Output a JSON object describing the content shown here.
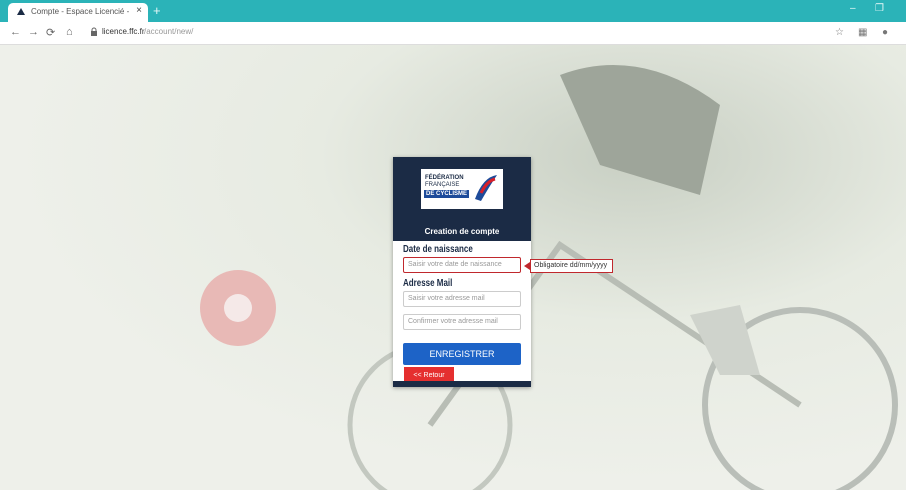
{
  "browser": {
    "tab_title": "Compte - Espace Licencié - FFC",
    "tab_close": "×",
    "new_tab": "+",
    "url_host": "licence.ffc.fr",
    "url_path": "/account/new/",
    "minimize": "–",
    "maximize": "❐"
  },
  "logo": {
    "line1": "FÉDÉRATION",
    "line2": "FRANÇAISE",
    "line3": "DE CYCLISME"
  },
  "form": {
    "title": "Creation de compte",
    "dob_label": "Date de naissance",
    "dob_placeholder": "Saisir votre date de naissance",
    "dob_error": "Obligatoire dd/mm/yyyy",
    "email_label": "Adresse Mail",
    "email_placeholder": "Saisir votre adresse mail",
    "email_confirm_placeholder": "Confirmer votre adresse mail",
    "save_label": "ENREGISTRER",
    "back_label": "<< Retour"
  },
  "colors": {
    "tabbar": "#2bb3b8",
    "card_header": "#1b2b45",
    "primary_button": "#1d63c7",
    "back_button": "#e52f2f",
    "error": "#c0282d"
  }
}
